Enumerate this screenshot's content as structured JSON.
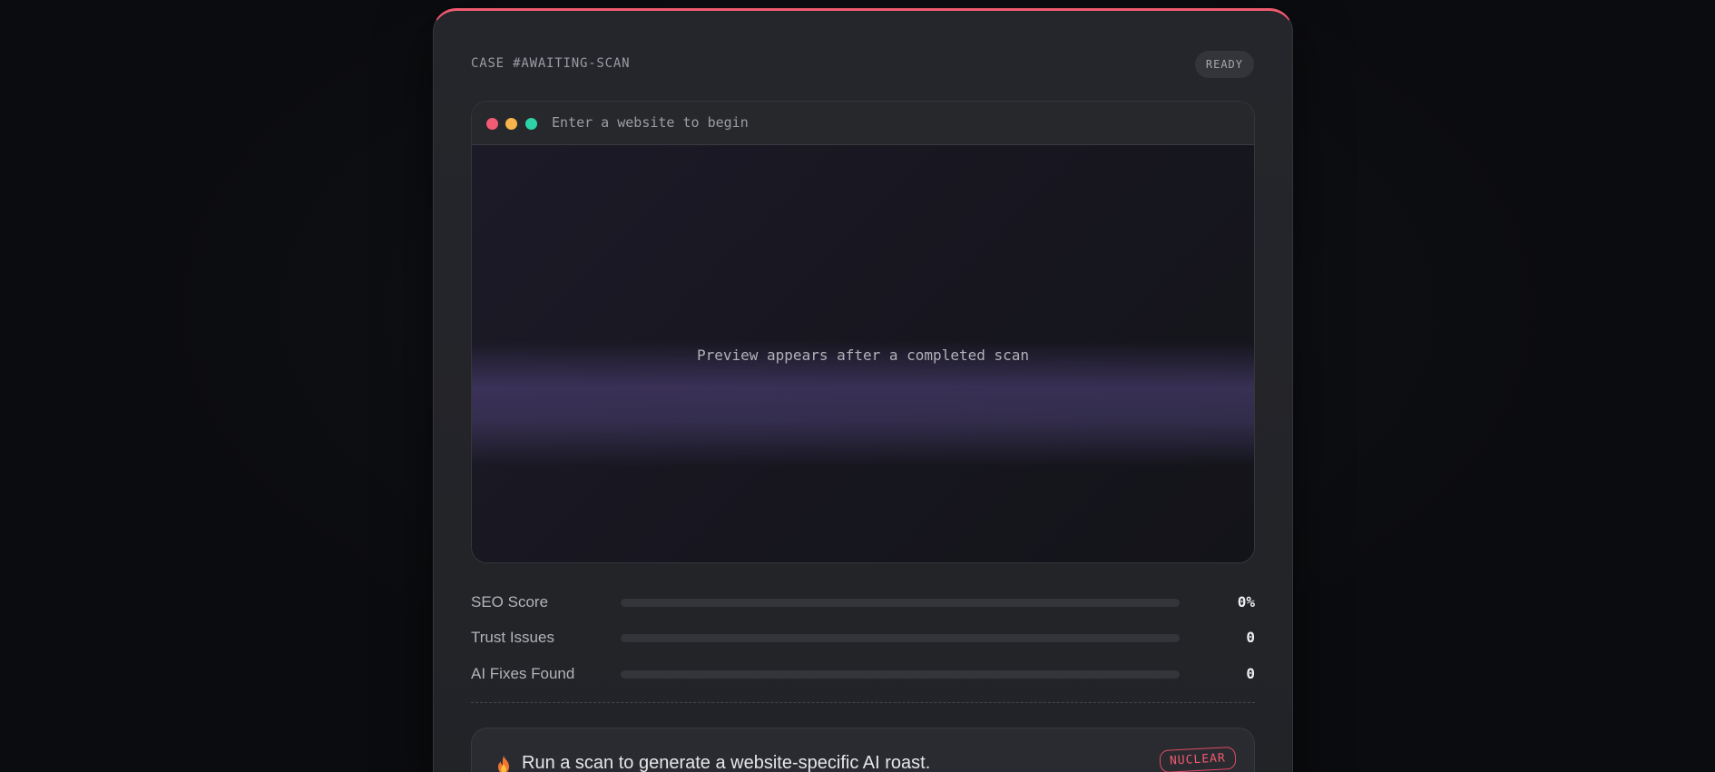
{
  "case": {
    "id_label": "CASE #AWAITING-SCAN",
    "status": "READY"
  },
  "browser": {
    "url_placeholder": "Enter a website to begin",
    "preview_message": "Preview appears after a completed scan"
  },
  "metrics": [
    {
      "label": "SEO Score",
      "value": "0%",
      "progress": 0
    },
    {
      "label": "Trust Issues",
      "value": "0",
      "progress": 0
    },
    {
      "label": "AI Fixes Found",
      "value": "0",
      "progress": 0
    }
  ],
  "roast": {
    "icon": "fire-icon",
    "message": "Run a scan to generate a website-specific AI roast.",
    "intensity_badge": "NUCLEAR"
  },
  "colors": {
    "accent": "#ef5a6f",
    "dot_red": "#f15b74",
    "dot_yellow": "#f6b54a",
    "dot_green": "#2fd1a6"
  }
}
